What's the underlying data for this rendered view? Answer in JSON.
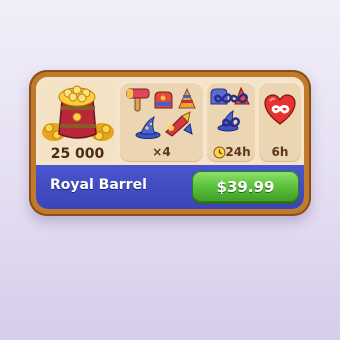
{
  "offer": {
    "name": "Royal Barrel",
    "price": "$39.99",
    "coins": "25 000",
    "boosters": "×4",
    "infinite_boosters_duration": "24h",
    "infinite_lives_duration": "6h"
  },
  "colors": {
    "frame": "#c07a2b",
    "panel": "#ebd5b3",
    "title_bar": "#3f4bc0",
    "buy_button": "#5bc23c",
    "heart": "#e8322f"
  },
  "icons": [
    "coin-barrel-icon",
    "hammer-icon",
    "glove-icon",
    "wizard-hat-icon",
    "rocket-icon",
    "infinity-icon",
    "clock-icon",
    "heart-icon"
  ]
}
